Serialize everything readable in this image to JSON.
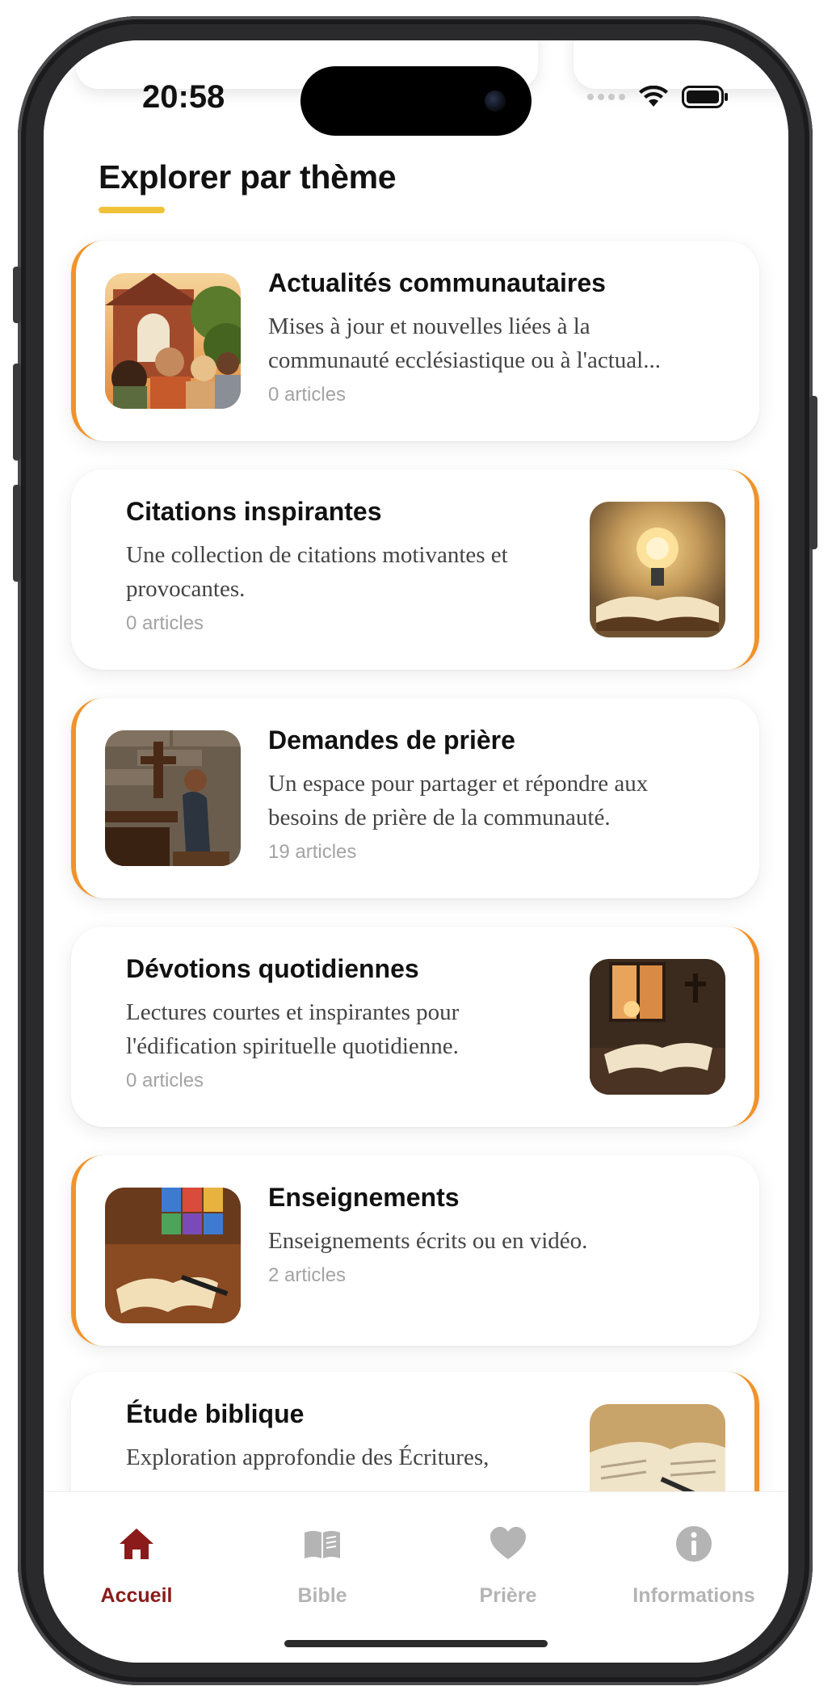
{
  "status_bar": {
    "time": "20:58"
  },
  "section": {
    "title": "Explorer par thème"
  },
  "themes": [
    {
      "title": "Actualités communautaires",
      "desc_lines": [
        "Mises à jour et nouvelles liées à la",
        "communauté ecclésiastique ou à l'actual..."
      ],
      "count": "0 articles"
    },
    {
      "title": "Citations inspirantes",
      "desc_lines": [
        "Une collection de citations motivantes et",
        "provocantes."
      ],
      "count": "0 articles"
    },
    {
      "title": "Demandes de prière",
      "desc_lines": [
        "Un espace pour partager et répondre aux",
        "besoins de prière de la communauté."
      ],
      "count": "19 articles"
    },
    {
      "title": "Dévotions quotidiennes",
      "desc_lines": [
        "Lectures courtes et inspirantes pour",
        "l'édification spirituelle quotidienne."
      ],
      "count": "0 articles"
    },
    {
      "title": "Enseignements",
      "desc_lines": [
        "Enseignements écrits ou en vidéo."
      ],
      "count": "2 articles"
    },
    {
      "title": "Étude biblique",
      "desc_lines": [
        "Exploration approfondie des Écritures,"
      ],
      "count": ""
    }
  ],
  "tabbar": {
    "home": "Accueil",
    "bible": "Bible",
    "prayer": "Prière",
    "info": "Informations"
  },
  "colors": {
    "accent": "#f0932a",
    "underline": "#f0c23a",
    "active_tab": "#8b1a1a",
    "inactive_tab": "#b4b4b4"
  }
}
